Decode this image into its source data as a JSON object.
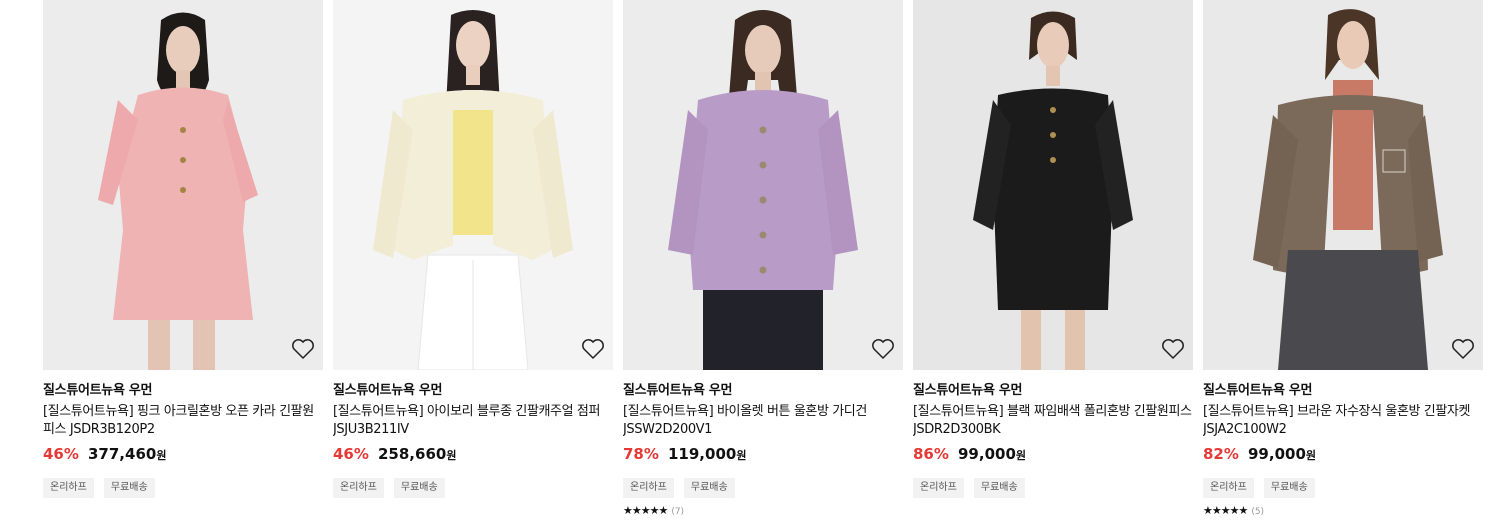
{
  "products": [
    {
      "brand": "질스튜어트뉴욕 우먼",
      "name": "[질스튜어트뉴욕] 핑크 아크릴혼방 오픈 카라 긴팔원피스 JSDR3B120P2",
      "discount": "46%",
      "price": "377,460",
      "currency": "원",
      "tags": [
        "온리하프",
        "무료배송"
      ],
      "rating": null,
      "review_count": null,
      "image": "model-in-pink-tweed-dress",
      "colors": {
        "garment": "#efb3b4",
        "bg": "#ececec"
      }
    },
    {
      "brand": "질스튜어트뉴욕 우먼",
      "name": "[질스튜어트뉴욕] 아이보리 블루종 긴팔캐주얼 점퍼 JSJU3B211IV",
      "discount": "46%",
      "price": "258,660",
      "currency": "원",
      "tags": [
        "온리하프",
        "무료배송"
      ],
      "rating": null,
      "review_count": null,
      "image": "model-in-ivory-blouson-jacket",
      "colors": {
        "garment": "#f3eed8",
        "bg": "#f4f4f4"
      }
    },
    {
      "brand": "질스튜어트뉴욕 우먼",
      "name": "[질스튜어트뉴욕] 바이올렛 버튼 울혼방 가디건 JSSW2D200V1",
      "discount": "78%",
      "price": "119,000",
      "currency": "원",
      "tags": [
        "온리하프",
        "무료배송"
      ],
      "rating": 4.5,
      "stars_text": "★★★★★",
      "review_count": "(7)",
      "image": "model-in-violet-cardigan",
      "colors": {
        "garment": "#b89bc6",
        "bg": "#ececec"
      }
    },
    {
      "brand": "질스튜어트뉴욕 우먼",
      "name": "[질스튜어트뉴욕] 블랙 짜임배색 폴리혼방 긴팔원피스 JSDR2D300BK",
      "discount": "86%",
      "price": "99,000",
      "currency": "원",
      "tags": [
        "온리하프",
        "무료배송"
      ],
      "rating": null,
      "review_count": null,
      "image": "model-in-black-dress",
      "colors": {
        "garment": "#1b1b1b",
        "bg": "#e6e6e6"
      }
    },
    {
      "brand": "질스튜어트뉴욕 우먼",
      "name": "[질스튜어트뉴욕] 브라운 자수장식 울혼방 긴팔자켓 JSJA2C100W2",
      "discount": "82%",
      "price": "99,000",
      "currency": "원",
      "tags": [
        "온리하프",
        "무료배송"
      ],
      "rating": 5,
      "stars_text": "★★★★★",
      "review_count": "(5)",
      "image": "model-in-brown-check-jacket",
      "colors": {
        "garment": "#7b6a5a",
        "bg": "#e9e9e9"
      }
    }
  ],
  "icons": {
    "wishlist": "heart-outline-icon",
    "star": "star-icon"
  }
}
